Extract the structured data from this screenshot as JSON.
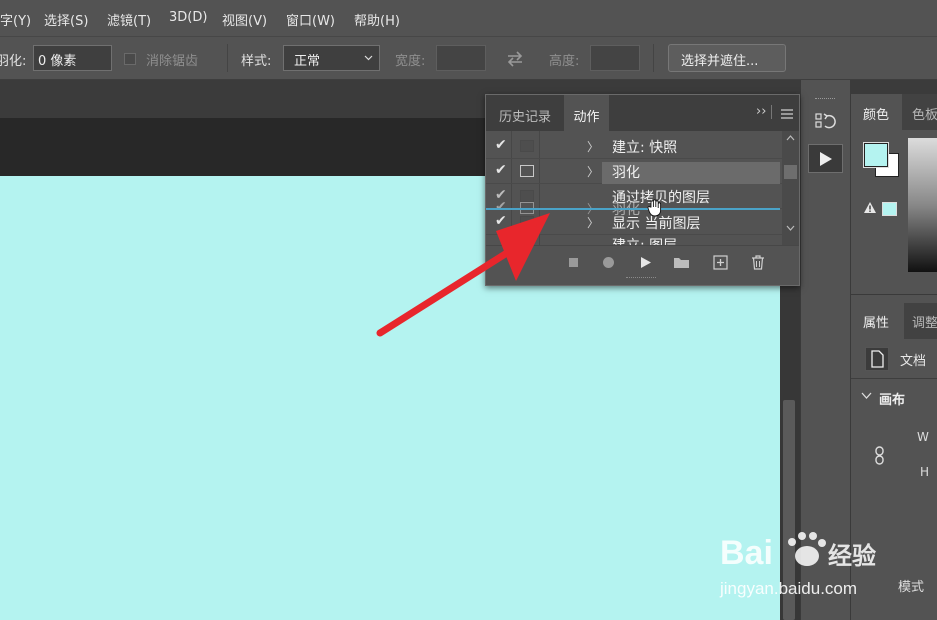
{
  "menubar": {
    "items": [
      "字(Y)",
      "选择(S)",
      "滤镜(T)",
      "3D(D)",
      "视图(V)",
      "窗口(W)",
      "帮助(H)"
    ]
  },
  "options": {
    "feather_label": "羽化:",
    "feather_value": "0 像素",
    "antialias_label": "消除锯齿",
    "style_label": "样式:",
    "style_value": "正常",
    "width_label": "宽度:",
    "height_label": "高度:",
    "select_mask_button": "选择并遮住..."
  },
  "actions_panel": {
    "tabs": [
      "历史记录",
      "动作"
    ],
    "active_tab": "动作",
    "rows": [
      {
        "checked": true,
        "dialog": false,
        "label": "建立: 快照"
      },
      {
        "checked": true,
        "dialog": true,
        "label": "羽化",
        "highlighted": true
      },
      {
        "checked": true,
        "dialog": false,
        "label": "通过拷贝的图层"
      },
      {
        "checked": true,
        "dialog": true,
        "label": "羽化",
        "dragging": true
      },
      {
        "checked": true,
        "dialog": false,
        "label": "显示 当前图层"
      },
      {
        "checked": false,
        "dialog": false,
        "label": "建立: 图层"
      }
    ]
  },
  "right_panel": {
    "color_tab": "颜色",
    "swatch_tab": "色板",
    "props_tab": "属性",
    "adjust_tab": "调整",
    "doc_label": "文档",
    "canvas_section": "画布",
    "w_label": "W",
    "h_label": "H",
    "mode_label": "模式"
  },
  "colors": {
    "canvas": "#b4f3f0",
    "ui_panel": "#535353",
    "ui_dark": "#282828",
    "arrow": "#e8262c",
    "drop_line": "#4aa3c8",
    "foreground_swatch": "#b4f3f0",
    "background_swatch": "#ffffff"
  },
  "watermark": "Baidu经验 jingyan.baidu.com"
}
